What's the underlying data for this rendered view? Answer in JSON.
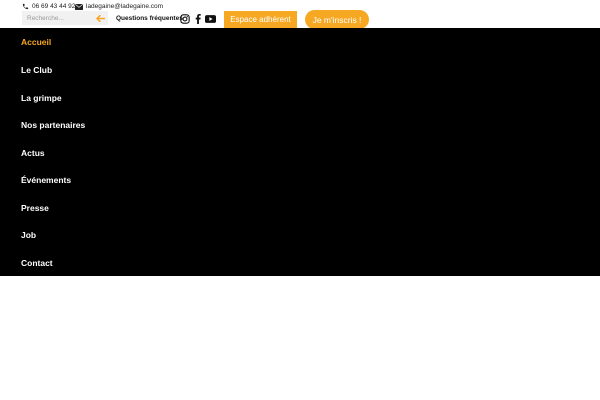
{
  "colors": {
    "accent": "#f7a823",
    "menu_bg": "#000000",
    "menu_text": "#ffffff",
    "search_bg": "#f1f1f1"
  },
  "topbar": {
    "phone": {
      "icon": "phone-icon",
      "text": "06 69 43 44 92"
    },
    "email": {
      "icon": "mail-icon",
      "text": "ladegaine@ladegaine.com"
    },
    "search": {
      "placeholder": "Recherche...",
      "value": "",
      "submit_icon": "arrow-left-icon"
    },
    "faq_label": "Questions fréquentes",
    "social": [
      {
        "name": "instagram",
        "icon": "instagram-icon"
      },
      {
        "name": "facebook",
        "icon": "facebook-icon"
      },
      {
        "name": "youtube",
        "icon": "youtube-icon"
      }
    ],
    "member_button": "Espace adhérent",
    "join_button": "Je m'inscris !"
  },
  "menu": {
    "active_index": 0,
    "items": [
      {
        "label": "Accueil"
      },
      {
        "label": "Le Club"
      },
      {
        "label": "La grimpe"
      },
      {
        "label": "Nos partenaires"
      },
      {
        "label": "Actus"
      },
      {
        "label": "Événements"
      },
      {
        "label": "Presse"
      },
      {
        "label": "Job"
      },
      {
        "label": "Contact"
      }
    ]
  }
}
